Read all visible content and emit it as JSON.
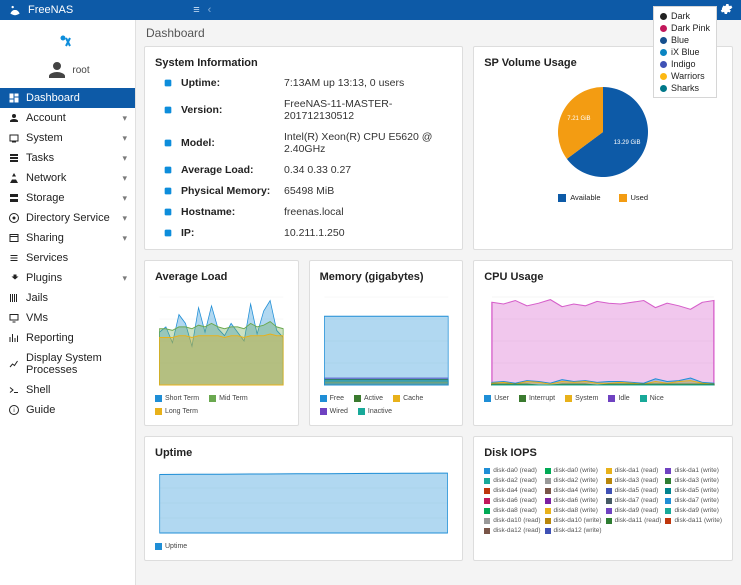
{
  "brand": "FreeNAS",
  "topbar": {
    "menu_glyph": "≡",
    "separator": "‹"
  },
  "theme_legend": [
    {
      "label": "Dark",
      "color": "#222"
    },
    {
      "label": "Dark Pink",
      "color": "#c2185b"
    },
    {
      "label": "Blue",
      "color": "#16508e"
    },
    {
      "label": "iX Blue",
      "color": "#0a84c1"
    },
    {
      "label": "Indigo",
      "color": "#3f51b5"
    },
    {
      "label": "Warriors",
      "color": "#fdb813"
    },
    {
      "label": "Sharks",
      "color": "#007889"
    }
  ],
  "account_label": "root",
  "nav": [
    {
      "key": "dashboard",
      "label": "Dashboard",
      "expandable": false,
      "active": true
    },
    {
      "key": "account",
      "label": "Account",
      "expandable": true
    },
    {
      "key": "system",
      "label": "System",
      "expandable": true
    },
    {
      "key": "tasks",
      "label": "Tasks",
      "expandable": true
    },
    {
      "key": "network",
      "label": "Network",
      "expandable": true
    },
    {
      "key": "storage",
      "label": "Storage",
      "expandable": true
    },
    {
      "key": "directory",
      "label": "Directory Service",
      "expandable": true
    },
    {
      "key": "sharing",
      "label": "Sharing",
      "expandable": true
    },
    {
      "key": "services",
      "label": "Services",
      "expandable": false
    },
    {
      "key": "plugins",
      "label": "Plugins",
      "expandable": true
    },
    {
      "key": "jails",
      "label": "Jails",
      "expandable": false
    },
    {
      "key": "vms",
      "label": "VMs",
      "expandable": false
    },
    {
      "key": "reporting",
      "label": "Reporting",
      "expandable": false
    },
    {
      "key": "procs",
      "label": "Display System Processes",
      "expandable": false
    },
    {
      "key": "shell",
      "label": "Shell",
      "expandable": false
    },
    {
      "key": "guide",
      "label": "Guide",
      "expandable": false
    }
  ],
  "page_title": "Dashboard",
  "cards": {
    "sysinfo": {
      "title": "System Information",
      "rows": [
        {
          "label": "Uptime:",
          "value": "7:13AM up 13:13, 0 users"
        },
        {
          "label": "Version:",
          "value": "FreeNAS-11-MASTER-201712130512"
        },
        {
          "label": "Model:",
          "value": "Intel(R) Xeon(R) CPU E5620 @ 2.40GHz"
        },
        {
          "label": "Average Load:",
          "value": "0.34 0.33 0.27"
        },
        {
          "label": "Physical Memory:",
          "value": "65498 MiB"
        },
        {
          "label": "Hostname:",
          "value": "freenas.local"
        },
        {
          "label": "IP:",
          "value": "10.211.1.250"
        }
      ]
    },
    "sp_volume": {
      "title": "SP Volume Usage",
      "legend": [
        {
          "label": "Available",
          "color": "#0d5aa7"
        },
        {
          "label": "Used",
          "color": "#f39c12"
        }
      ]
    },
    "avg_load": {
      "title": "Average Load",
      "legend": [
        {
          "label": "Short Term",
          "color": "#1f8ed6"
        },
        {
          "label": "Mid Term",
          "color": "#6aa84f"
        },
        {
          "label": "Long Term",
          "color": "#e8b11a"
        }
      ]
    },
    "memory": {
      "title": "Memory (gigabytes)",
      "legend": [
        {
          "label": "Free",
          "color": "#1f8ed6"
        },
        {
          "label": "Active",
          "color": "#3a7a2e"
        },
        {
          "label": "Cache",
          "color": "#e8b11a"
        },
        {
          "label": "Wired",
          "color": "#6f42c1"
        },
        {
          "label": "Inactive",
          "color": "#18a999"
        }
      ]
    },
    "cpu": {
      "title": "CPU Usage",
      "legend": [
        {
          "label": "User",
          "color": "#1f8ed6"
        },
        {
          "label": "Interrupt",
          "color": "#3a7a2e"
        },
        {
          "label": "System",
          "color": "#e8b11a"
        },
        {
          "label": "Idle",
          "color": "#6f42c1"
        },
        {
          "label": "Nice",
          "color": "#18a999"
        }
      ]
    },
    "uptime": {
      "title": "Uptime",
      "legend": [
        {
          "label": "Uptime",
          "color": "#1f8ed6"
        }
      ]
    },
    "disk_iops": {
      "title": "Disk IOPS",
      "legend": [
        {
          "label": "disk-da0 (read)",
          "color": "#1f8ed6"
        },
        {
          "label": "disk-da0 (write)",
          "color": "#0a5"
        },
        {
          "label": "disk-da1 (read)",
          "color": "#e8b11a"
        },
        {
          "label": "disk-da1 (write)",
          "color": "#6f42c1"
        },
        {
          "label": "disk-da2 (read)",
          "color": "#18a999"
        },
        {
          "label": "disk-da2 (write)",
          "color": "#999"
        },
        {
          "label": "disk-da3 (read)",
          "color": "#b8860b"
        },
        {
          "label": "disk-da3 (write)",
          "color": "#2e7d32"
        },
        {
          "label": "disk-da4 (read)",
          "color": "#bf360c"
        },
        {
          "label": "disk-da4 (write)",
          "color": "#795548"
        },
        {
          "label": "disk-da5 (read)",
          "color": "#3f51b5"
        },
        {
          "label": "disk-da5 (write)",
          "color": "#00838f"
        },
        {
          "label": "disk-da6 (read)",
          "color": "#c2185b"
        },
        {
          "label": "disk-da6 (write)",
          "color": "#7b1fa2"
        },
        {
          "label": "disk-da7 (read)",
          "color": "#455a64"
        },
        {
          "label": "disk-da7 (write)",
          "color": "#1f8ed6"
        },
        {
          "label": "disk-da8 (read)",
          "color": "#0a5"
        },
        {
          "label": "disk-da8 (write)",
          "color": "#e8b11a"
        },
        {
          "label": "disk-da9 (read)",
          "color": "#6f42c1"
        },
        {
          "label": "disk-da9 (write)",
          "color": "#18a999"
        },
        {
          "label": "disk-da10 (read)",
          "color": "#999"
        },
        {
          "label": "disk-da10 (write)",
          "color": "#b8860b"
        },
        {
          "label": "disk-da11 (read)",
          "color": "#2e7d32"
        },
        {
          "label": "disk-da11 (write)",
          "color": "#bf360c"
        },
        {
          "label": "disk-da12 (read)",
          "color": "#795548"
        },
        {
          "label": "disk-da12 (write)",
          "color": "#3f51b5"
        }
      ]
    }
  },
  "chart_data": [
    {
      "id": "sp_volume",
      "type": "pie",
      "title": "SP Volume Usage",
      "series": [
        {
          "name": "Available",
          "value": 13.29,
          "unit": "GiB",
          "color": "#0d5aa7",
          "label": "13.29 GiB"
        },
        {
          "name": "Used",
          "value": 7.21,
          "unit": "GiB",
          "color": "#f39c12",
          "label": "7.21 GiB"
        }
      ]
    },
    {
      "id": "avg_load",
      "type": "area",
      "title": "Average Load",
      "ylim": [
        0.0,
        0.5
      ],
      "x_range_minutes": 10,
      "series": [
        {
          "name": "Short Term",
          "color": "#1f8ed6",
          "values": [
            0.3,
            0.33,
            0.24,
            0.4,
            0.35,
            0.22,
            0.44,
            0.3,
            0.45,
            0.32,
            0.28,
            0.35,
            0.3,
            0.25,
            0.46,
            0.29,
            0.42,
            0.48,
            0.31,
            0.27
          ]
        },
        {
          "name": "Mid Term",
          "color": "#6aa84f",
          "values": [
            0.32,
            0.32,
            0.31,
            0.33,
            0.33,
            0.32,
            0.34,
            0.33,
            0.35,
            0.33,
            0.32,
            0.33,
            0.33,
            0.32,
            0.35,
            0.33,
            0.34,
            0.36,
            0.33,
            0.32
          ]
        },
        {
          "name": "Long Term",
          "color": "#e8b11a",
          "values": [
            0.27,
            0.27,
            0.27,
            0.28,
            0.28,
            0.27,
            0.28,
            0.28,
            0.28,
            0.28,
            0.27,
            0.28,
            0.28,
            0.27,
            0.28,
            0.28,
            0.28,
            0.29,
            0.28,
            0.28
          ]
        }
      ]
    },
    {
      "id": "memory",
      "type": "area",
      "title": "Memory (gigabytes)",
      "ylim": [
        0,
        64
      ],
      "x_range_minutes": 10,
      "stacked": true,
      "series": [
        {
          "name": "Wired",
          "color": "#6f42c1",
          "values": [
            5,
            5,
            5,
            5,
            5,
            5,
            5,
            5,
            5,
            5,
            5,
            5,
            5,
            5,
            5,
            5,
            5,
            5,
            5,
            5
          ]
        },
        {
          "name": "Active",
          "color": "#3a7a2e",
          "values": [
            4,
            4,
            4,
            4,
            4,
            4,
            4,
            4,
            4,
            4,
            4,
            4,
            4,
            4,
            4,
            4,
            4,
            4,
            4,
            4
          ]
        },
        {
          "name": "Cache",
          "color": "#e8b11a",
          "values": [
            2,
            2,
            2,
            2,
            2,
            2,
            2,
            2,
            2,
            2,
            2,
            2,
            2,
            2,
            2,
            2,
            2,
            2,
            2,
            2
          ]
        },
        {
          "name": "Inactive",
          "color": "#18a999",
          "values": [
            3,
            3,
            3,
            3,
            3,
            3,
            3,
            3,
            3,
            3,
            3,
            3,
            3,
            3,
            3,
            3,
            3,
            3,
            3,
            3
          ]
        },
        {
          "name": "Free",
          "color": "#1f8ed6",
          "values": [
            50,
            50,
            50,
            50,
            50,
            50,
            50,
            50,
            50,
            50,
            50,
            50,
            50,
            50,
            50,
            50,
            50,
            50,
            50,
            50
          ]
        }
      ]
    },
    {
      "id": "cpu",
      "type": "area",
      "title": "CPU Usage",
      "ylim": [
        0,
        100
      ],
      "unit": "%",
      "x_range_minutes": 10,
      "series": [
        {
          "name": "Idle",
          "color": "#d65fca",
          "values": [
            94,
            92,
            96,
            90,
            93,
            97,
            89,
            92,
            90,
            95,
            93,
            92,
            94,
            96,
            88,
            93,
            90,
            86,
            94,
            96
          ]
        },
        {
          "name": "User",
          "color": "#1f8ed6",
          "values": [
            3,
            4,
            2,
            5,
            4,
            2,
            6,
            4,
            5,
            3,
            4,
            4,
            3,
            2,
            7,
            4,
            5,
            8,
            3,
            2
          ]
        },
        {
          "name": "System",
          "color": "#e8b11a",
          "values": [
            2,
            3,
            1,
            4,
            3,
            1,
            4,
            3,
            4,
            2,
            2,
            3,
            2,
            1,
            4,
            2,
            4,
            5,
            2,
            1
          ]
        },
        {
          "name": "Interrupt",
          "color": "#3a7a2e",
          "values": [
            1,
            1,
            1,
            1,
            0,
            0,
            1,
            1,
            1,
            0,
            1,
            1,
            1,
            1,
            1,
            1,
            1,
            1,
            1,
            1
          ]
        },
        {
          "name": "Nice",
          "color": "#18a999",
          "values": [
            0,
            0,
            0,
            0,
            0,
            0,
            0,
            0,
            0,
            0,
            0,
            0,
            0,
            0,
            0,
            0,
            0,
            0,
            0,
            0
          ]
        }
      ]
    },
    {
      "id": "uptime",
      "type": "line",
      "title": "Uptime",
      "ylim": [
        0,
        48000
      ],
      "unit": "seconds",
      "x_range_minutes": 10,
      "series": [
        {
          "name": "Uptime",
          "color": "#1f8ed6",
          "values": [
            46800,
            46860,
            46920,
            46980,
            47040,
            47100,
            47160,
            47220,
            47280,
            47340,
            47400,
            47460,
            47520,
            47580,
            47640,
            47700,
            47760,
            47820,
            47880,
            47940
          ]
        }
      ]
    }
  ]
}
